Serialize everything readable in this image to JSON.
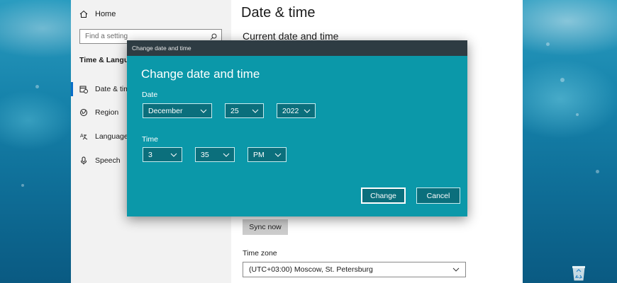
{
  "settings": {
    "nav": {
      "home_label": "Home",
      "search_placeholder": "Find a setting",
      "section_title": "Time & Langua",
      "items": [
        {
          "label": "Date & tim",
          "icon": "calendar-clock-icon"
        },
        {
          "label": "Region",
          "icon": "globe-icon"
        },
        {
          "label": "Language",
          "icon": "language-icon"
        },
        {
          "label": "Speech",
          "icon": "microphone-icon"
        }
      ]
    },
    "content": {
      "page_title": "Date & time",
      "section_title": "Current date and time",
      "sync_button": "Sync now",
      "timezone_label": "Time zone",
      "timezone_value": "(UTC+03:00) Moscow, St. Petersburg"
    }
  },
  "dialog": {
    "window_title": "Change date and time",
    "heading": "Change date and time",
    "date_label": "Date",
    "month": "December",
    "day": "25",
    "year": "2022",
    "time_label": "Time",
    "hour": "3",
    "minute": "35",
    "ampm": "PM",
    "change_button": "Change",
    "cancel_button": "Cancel"
  },
  "colors": {
    "dialog_bg": "#0b98a9",
    "dialog_titlebar": "#2e3c43",
    "accent": "#0a6ec8"
  }
}
